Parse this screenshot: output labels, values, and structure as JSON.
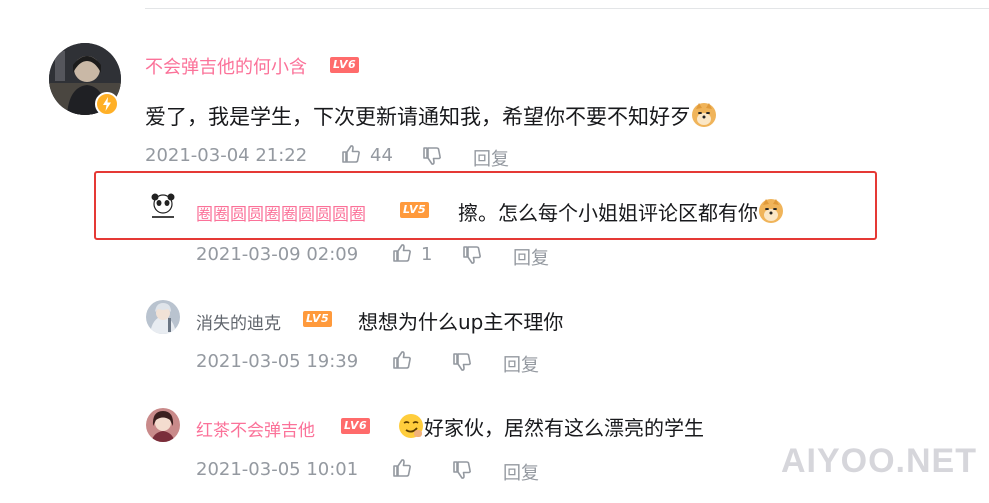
{
  "colors": {
    "username_pink": "#fb7299",
    "meta_gray": "#9499a0",
    "highlight_red": "#e53935",
    "lv6": "#ff6b6b",
    "lv5": "#ff9a3c"
  },
  "main_comment": {
    "username": "不会弹吉他的何小含",
    "level": "LV6",
    "avatar_badge_icon": "lightning-icon",
    "text": "爱了，我是学生，下次更新请通知我，希望你不要不知好歹",
    "emoji": "doge-emoji",
    "timestamp": "2021-03-04 21:22",
    "likes": "44",
    "reply_label": "回复"
  },
  "replies": [
    {
      "username": "圈圈圆圆圈圈圆圆圆圈",
      "level": "LV5",
      "text": "擦。怎么每个小姐姐评论区都有你",
      "emoji": "doge-emoji",
      "timestamp": "2021-03-09 02:09",
      "likes": "1",
      "reply_label": "回复",
      "highlighted": true
    },
    {
      "username": "消失的迪克",
      "level": "LV5",
      "text": "想想为什么up主不理你",
      "timestamp": "2021-03-05 19:39",
      "likes": "",
      "reply_label": "回复"
    },
    {
      "username": "红茶不会弹吉他",
      "level": "LV6",
      "text": "好家伙，居然有这么漂亮的学生",
      "emoji": "smirk-emoji",
      "timestamp": "2021-03-05 10:01",
      "likes": "",
      "reply_label": "回复"
    }
  ],
  "watermark": "AIYOO.NET"
}
